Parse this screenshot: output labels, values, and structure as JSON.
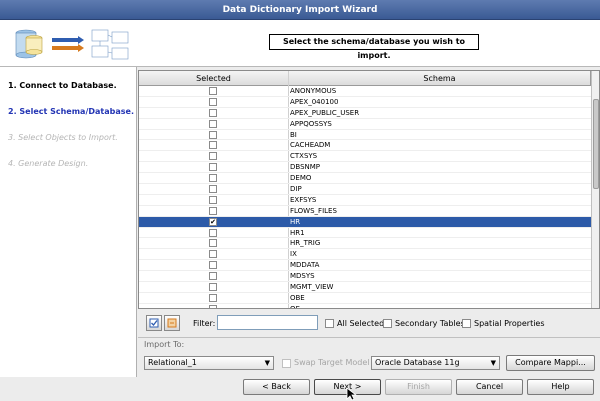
{
  "window": {
    "title": "Data Dictionary Import Wizard"
  },
  "header": {
    "prompt": "Select the schema/database you wish to import."
  },
  "steps": [
    {
      "label": "1. Connect to Database.",
      "state": "done"
    },
    {
      "label": "2. Select Schema/Database.",
      "state": "current"
    },
    {
      "label": "3. Select Objects to Import.",
      "state": "future"
    },
    {
      "label": "4. Generate Design.",
      "state": "future"
    }
  ],
  "grid": {
    "columns": [
      "Selected",
      "Schema"
    ],
    "rows": [
      {
        "schema": "ANONYMOUS",
        "checked": false
      },
      {
        "schema": "APEX_040100",
        "checked": false
      },
      {
        "schema": "APEX_PUBLIC_USER",
        "checked": false
      },
      {
        "schema": "APPQOSSYS",
        "checked": false
      },
      {
        "schema": "BI",
        "checked": false
      },
      {
        "schema": "CACHEADM",
        "checked": false
      },
      {
        "schema": "CTXSYS",
        "checked": false
      },
      {
        "schema": "DBSNMP",
        "checked": false
      },
      {
        "schema": "DEMO",
        "checked": false
      },
      {
        "schema": "DIP",
        "checked": false
      },
      {
        "schema": "EXFSYS",
        "checked": false
      },
      {
        "schema": "FLOWS_FILES",
        "checked": false
      },
      {
        "schema": "HR",
        "checked": true,
        "selected": true
      },
      {
        "schema": "HR1",
        "checked": false
      },
      {
        "schema": "HR_TRIG",
        "checked": false
      },
      {
        "schema": "IX",
        "checked": false
      },
      {
        "schema": "MDDATA",
        "checked": false
      },
      {
        "schema": "MDSYS",
        "checked": false
      },
      {
        "schema": "MGMT_VIEW",
        "checked": false
      },
      {
        "schema": "OBE",
        "checked": false
      },
      {
        "schema": "OE",
        "checked": false
      }
    ]
  },
  "filter": {
    "label": "Filter:",
    "value": "",
    "all_selected": "All Selected",
    "secondary_tables": "Secondary Tables",
    "spatial_properties": "Spatial Properties"
  },
  "import_to": {
    "label": "Import To:",
    "model": "Relational_1",
    "swap_target": "Swap Target Model",
    "database": "Oracle Database 11g",
    "compare_button": "Compare Mappi..."
  },
  "buttons": {
    "back": "< Back",
    "next": "Next >",
    "finish": "Finish",
    "cancel": "Cancel",
    "help": "Help"
  },
  "colors": {
    "accent": "#2c5aa8",
    "title_bar": "#4a6aa4",
    "current_step": "#2234b4"
  }
}
